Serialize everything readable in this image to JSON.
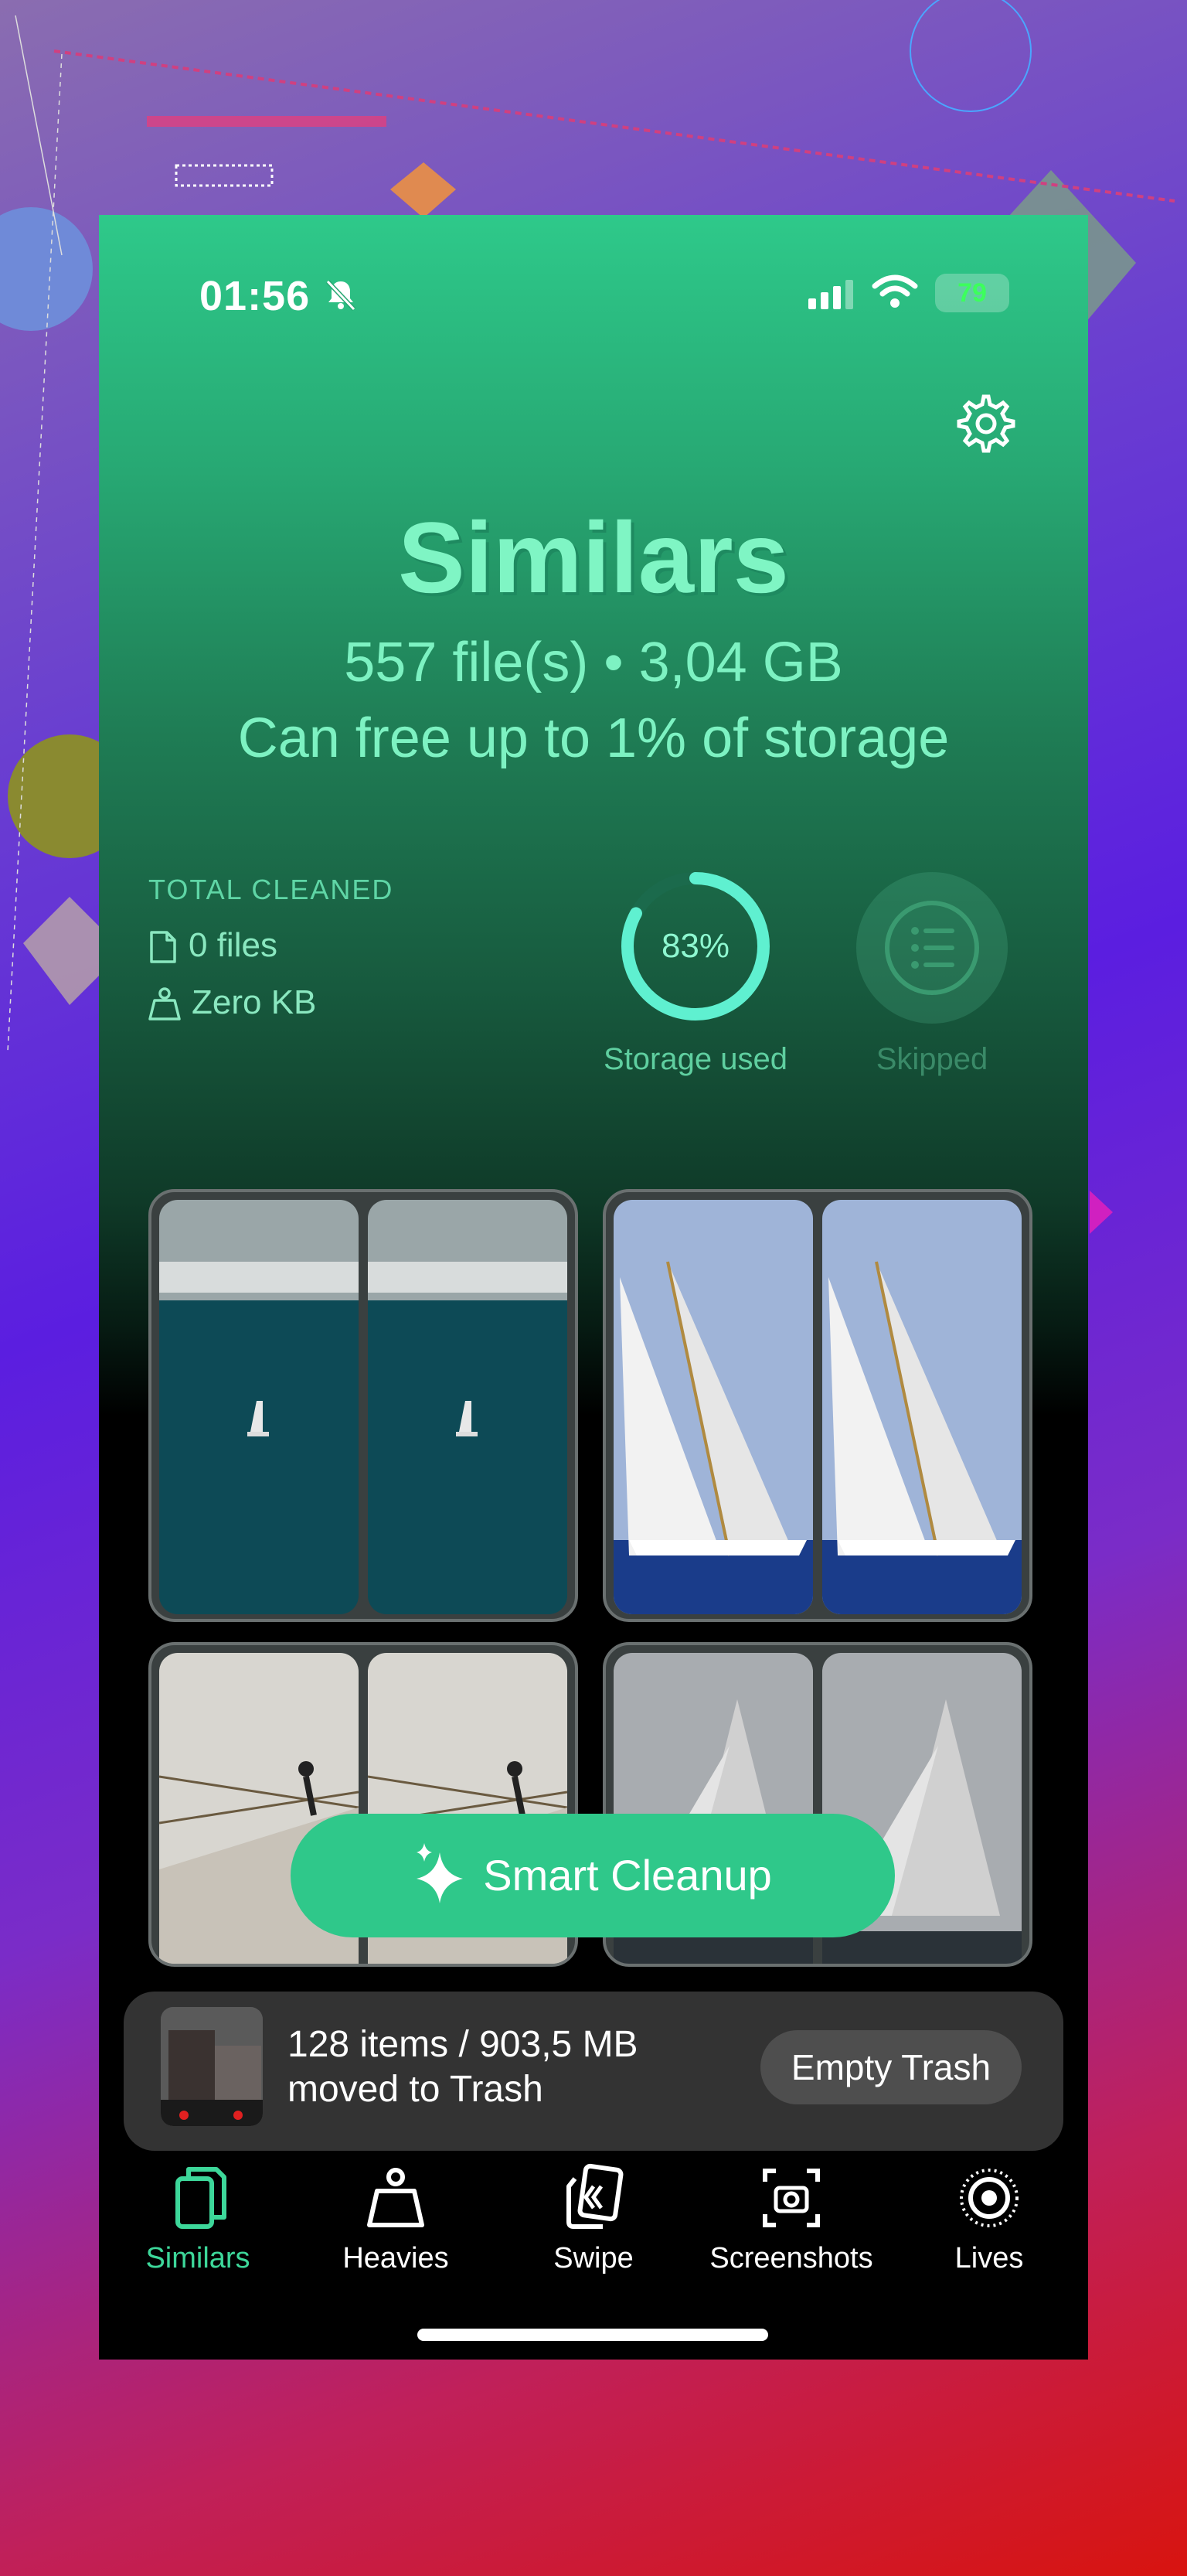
{
  "status": {
    "time": "01:56",
    "battery": "79"
  },
  "header": {
    "title": "Similars",
    "summary": "557 file(s) • 3,04 GB",
    "free_note": "Can free up to 1% of storage"
  },
  "stats": {
    "total_cleaned_label": "TOTAL CLEANED",
    "files": "0 files",
    "size": "Zero KB",
    "storage_percent": "83%",
    "storage_fraction": 0.83,
    "storage_label": "Storage used",
    "skipped_label": "Skipped"
  },
  "smart_cleanup": {
    "label": "Smart Cleanup"
  },
  "trash": {
    "line1": "128 items / 903,5 MB",
    "line2": "moved to Trash",
    "button": "Empty Trash"
  },
  "tabs": [
    {
      "label": "Similars",
      "icon": "similars-icon",
      "active": true
    },
    {
      "label": "Heavies",
      "icon": "weight-icon"
    },
    {
      "label": "Swipe",
      "icon": "swipe-icon"
    },
    {
      "label": "Screenshots",
      "icon": "screenshot-icon"
    },
    {
      "label": "Lives",
      "icon": "live-photo-icon"
    }
  ],
  "colors": {
    "accent": "#2fc88a",
    "title": "#7ff5c4"
  }
}
